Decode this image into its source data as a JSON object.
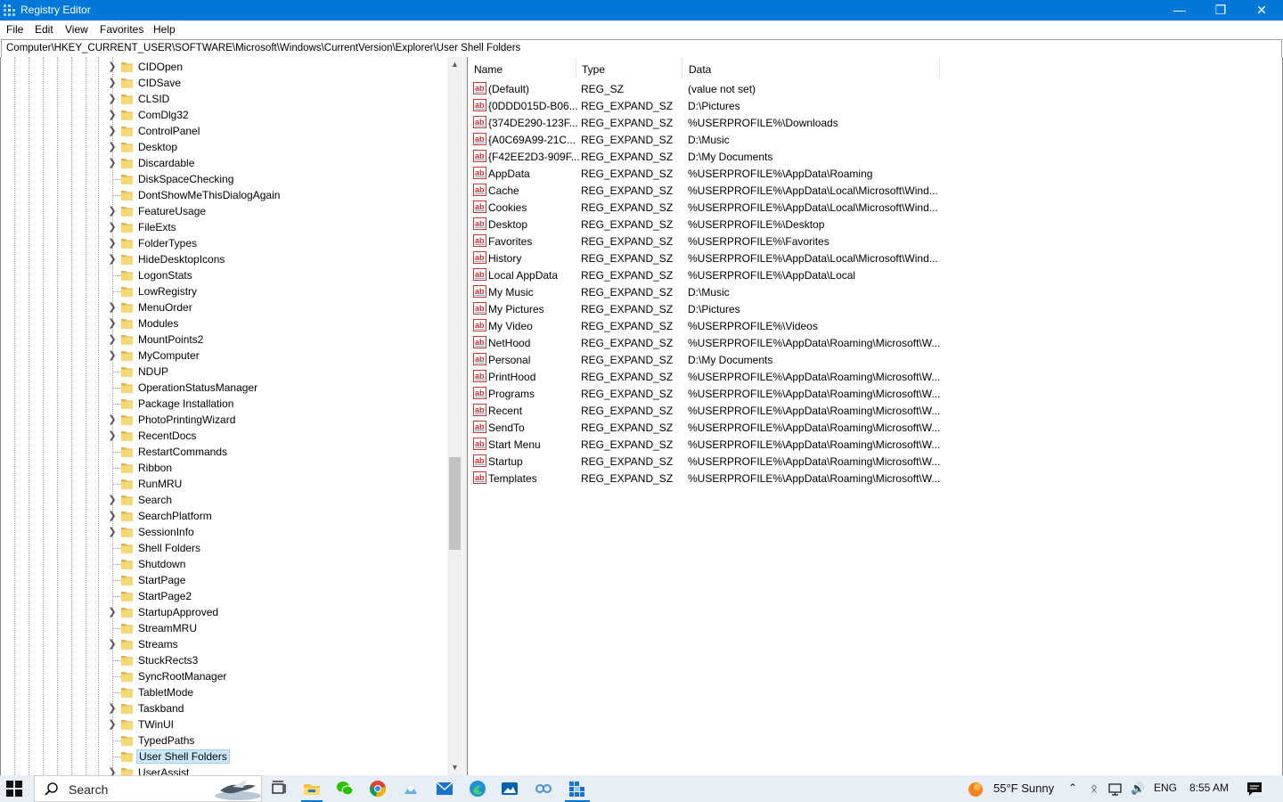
{
  "window": {
    "title": "Registry Editor"
  },
  "menu": [
    "File",
    "Edit",
    "View",
    "Favorites",
    "Help"
  ],
  "address": "Computer\\HKEY_CURRENT_USER\\SOFTWARE\\Microsoft\\Windows\\CurrentVersion\\Explorer\\User Shell Folders",
  "tree": [
    {
      "label": "CIDOpen",
      "expandable": true
    },
    {
      "label": "CIDSave",
      "expandable": true
    },
    {
      "label": "CLSID",
      "expandable": true
    },
    {
      "label": "ComDlg32",
      "expandable": true
    },
    {
      "label": "ControlPanel",
      "expandable": true
    },
    {
      "label": "Desktop",
      "expandable": true
    },
    {
      "label": "Discardable",
      "expandable": true
    },
    {
      "label": "DiskSpaceChecking",
      "expandable": false
    },
    {
      "label": "DontShowMeThisDialogAgain",
      "expandable": false
    },
    {
      "label": "FeatureUsage",
      "expandable": true
    },
    {
      "label": "FileExts",
      "expandable": true
    },
    {
      "label": "FolderTypes",
      "expandable": true
    },
    {
      "label": "HideDesktopIcons",
      "expandable": true
    },
    {
      "label": "LogonStats",
      "expandable": false
    },
    {
      "label": "LowRegistry",
      "expandable": false
    },
    {
      "label": "MenuOrder",
      "expandable": true
    },
    {
      "label": "Modules",
      "expandable": true
    },
    {
      "label": "MountPoints2",
      "expandable": true
    },
    {
      "label": "MyComputer",
      "expandable": true
    },
    {
      "label": "NDUP",
      "expandable": false
    },
    {
      "label": "OperationStatusManager",
      "expandable": false
    },
    {
      "label": "Package Installation",
      "expandable": false
    },
    {
      "label": "PhotoPrintingWizard",
      "expandable": true
    },
    {
      "label": "RecentDocs",
      "expandable": true
    },
    {
      "label": "RestartCommands",
      "expandable": false
    },
    {
      "label": "Ribbon",
      "expandable": false
    },
    {
      "label": "RunMRU",
      "expandable": false
    },
    {
      "label": "Search",
      "expandable": true
    },
    {
      "label": "SearchPlatform",
      "expandable": true
    },
    {
      "label": "SessionInfo",
      "expandable": true
    },
    {
      "label": "Shell Folders",
      "expandable": false
    },
    {
      "label": "Shutdown",
      "expandable": false
    },
    {
      "label": "StartPage",
      "expandable": false
    },
    {
      "label": "StartPage2",
      "expandable": false
    },
    {
      "label": "StartupApproved",
      "expandable": true
    },
    {
      "label": "StreamMRU",
      "expandable": false
    },
    {
      "label": "Streams",
      "expandable": true
    },
    {
      "label": "StuckRects3",
      "expandable": false
    },
    {
      "label": "SyncRootManager",
      "expandable": false
    },
    {
      "label": "TabletMode",
      "expandable": false
    },
    {
      "label": "Taskband",
      "expandable": true
    },
    {
      "label": "TWinUI",
      "expandable": true
    },
    {
      "label": "TypedPaths",
      "expandable": false
    },
    {
      "label": "User Shell Folders",
      "expandable": false,
      "selected": true
    },
    {
      "label": "UserAssist",
      "expandable": true
    }
  ],
  "columns": {
    "name": "Name",
    "type": "Type",
    "data": "Data"
  },
  "values": [
    {
      "name": "(Default)",
      "type": "REG_SZ",
      "data": "(value not set)"
    },
    {
      "name": "{0DDD015D-B06...",
      "type": "REG_EXPAND_SZ",
      "data": "D:\\Pictures"
    },
    {
      "name": "{374DE290-123F...",
      "type": "REG_EXPAND_SZ",
      "data": "%USERPROFILE%\\Downloads"
    },
    {
      "name": "{A0C69A99-21C...",
      "type": "REG_EXPAND_SZ",
      "data": "D:\\Music"
    },
    {
      "name": "{F42EE2D3-909F...",
      "type": "REG_EXPAND_SZ",
      "data": "D:\\My Documents"
    },
    {
      "name": "AppData",
      "type": "REG_EXPAND_SZ",
      "data": "%USERPROFILE%\\AppData\\Roaming"
    },
    {
      "name": "Cache",
      "type": "REG_EXPAND_SZ",
      "data": "%USERPROFILE%\\AppData\\Local\\Microsoft\\Wind..."
    },
    {
      "name": "Cookies",
      "type": "REG_EXPAND_SZ",
      "data": "%USERPROFILE%\\AppData\\Local\\Microsoft\\Wind..."
    },
    {
      "name": "Desktop",
      "type": "REG_EXPAND_SZ",
      "data": "%USERPROFILE%\\Desktop"
    },
    {
      "name": "Favorites",
      "type": "REG_EXPAND_SZ",
      "data": "%USERPROFILE%\\Favorites"
    },
    {
      "name": "History",
      "type": "REG_EXPAND_SZ",
      "data": "%USERPROFILE%\\AppData\\Local\\Microsoft\\Wind..."
    },
    {
      "name": "Local AppData",
      "type": "REG_EXPAND_SZ",
      "data": "%USERPROFILE%\\AppData\\Local"
    },
    {
      "name": "My Music",
      "type": "REG_EXPAND_SZ",
      "data": "D:\\Music"
    },
    {
      "name": "My Pictures",
      "type": "REG_EXPAND_SZ",
      "data": "D:\\Pictures"
    },
    {
      "name": "My Video",
      "type": "REG_EXPAND_SZ",
      "data": "%USERPROFILE%\\Videos"
    },
    {
      "name": "NetHood",
      "type": "REG_EXPAND_SZ",
      "data": "%USERPROFILE%\\AppData\\Roaming\\Microsoft\\W..."
    },
    {
      "name": "Personal",
      "type": "REG_EXPAND_SZ",
      "data": "D:\\My Documents"
    },
    {
      "name": "PrintHood",
      "type": "REG_EXPAND_SZ",
      "data": "%USERPROFILE%\\AppData\\Roaming\\Microsoft\\W..."
    },
    {
      "name": "Programs",
      "type": "REG_EXPAND_SZ",
      "data": "%USERPROFILE%\\AppData\\Roaming\\Microsoft\\W..."
    },
    {
      "name": "Recent",
      "type": "REG_EXPAND_SZ",
      "data": "%USERPROFILE%\\AppData\\Roaming\\Microsoft\\W..."
    },
    {
      "name": "SendTo",
      "type": "REG_EXPAND_SZ",
      "data": "%USERPROFILE%\\AppData\\Roaming\\Microsoft\\W..."
    },
    {
      "name": "Start Menu",
      "type": "REG_EXPAND_SZ",
      "data": "%USERPROFILE%\\AppData\\Roaming\\Microsoft\\W..."
    },
    {
      "name": "Startup",
      "type": "REG_EXPAND_SZ",
      "data": "%USERPROFILE%\\AppData\\Roaming\\Microsoft\\W..."
    },
    {
      "name": "Templates",
      "type": "REG_EXPAND_SZ",
      "data": "%USERPROFILE%\\AppData\\Roaming\\Microsoft\\W..."
    }
  ],
  "value_icon_text": "ab",
  "taskbar": {
    "search_label": "Search",
    "weather": "55°F  Sunny",
    "language": "ENG",
    "time": "8:55 AM"
  },
  "colors": {
    "titlebar": "#0078d7",
    "selection": "#cce8ff",
    "folder": "#f8d775"
  }
}
